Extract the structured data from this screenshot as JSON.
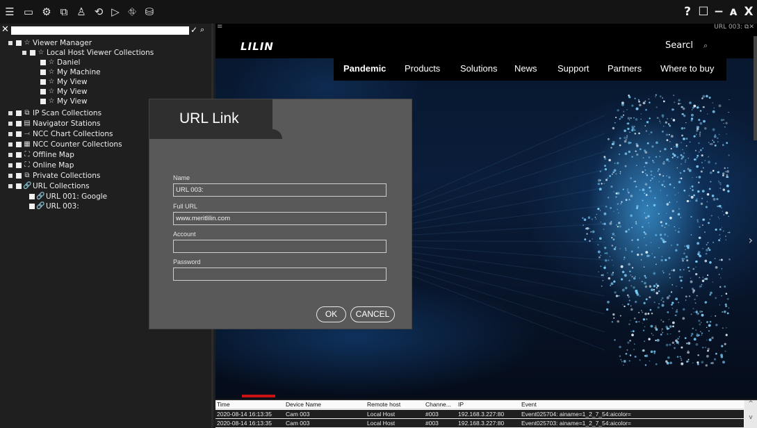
{
  "toolbar": {
    "icons": [
      "menu-icon",
      "monitor-icon",
      "settings-icon",
      "play-window-icon",
      "person-icon",
      "refresh-icon",
      "play-icon",
      "map-pin-icon",
      "database-icon"
    ],
    "glyphs": [
      "☰",
      "▭",
      "⚙",
      "⧉",
      "♙",
      "⟲",
      "▷",
      "⛗",
      "⛁"
    ],
    "window": {
      "help": "?",
      "maximize": "☐",
      "minimize": "−",
      "restore": "ᴀ",
      "close": "X"
    }
  },
  "filter": {
    "close": "✕",
    "confirm": "✓",
    "search": "⌕",
    "value": ""
  },
  "tree": [
    {
      "label": "Viewer Manager",
      "icon": "☆"
    },
    {
      "label": "Local Host Viewer Collections",
      "icon": "☆"
    },
    {
      "label": "Daniel",
      "icon": "☆"
    },
    {
      "label": "My Machine",
      "icon": "☆"
    },
    {
      "label": "My View",
      "icon": "☆"
    },
    {
      "label": "My View",
      "icon": "☆"
    },
    {
      "label": "My View",
      "icon": "☆"
    },
    {
      "label": "IP Scan Collections",
      "icon": "⧉"
    },
    {
      "label": "Navigator Stations",
      "icon": "▤"
    },
    {
      "label": "NCC Chart Collections",
      "icon": "⤙"
    },
    {
      "label": "NCC Counter Collections",
      "icon": "▦"
    },
    {
      "label": "Offline Map",
      "icon": "⛶"
    },
    {
      "label": "Online Map",
      "icon": "⛶"
    },
    {
      "label": "Private Collections",
      "icon": "⧉"
    },
    {
      "label": "URL Collections",
      "icon": "🔗"
    },
    {
      "label": "URL 001: Google",
      "icon": "🔗"
    },
    {
      "label": "URL 003:",
      "icon": "🔗"
    }
  ],
  "viewer": {
    "menu": "≡",
    "tab": "URL 003: ⧉✕",
    "site": {
      "logo": "LILIN",
      "search": "Searcl",
      "search_icon": "⌕",
      "nav": [
        "Pandemic",
        "Products",
        "Solutions",
        "News",
        "Support",
        "Partners",
        "Where to buy"
      ],
      "arrow": "›"
    }
  },
  "dialog": {
    "title": "URL Link",
    "fields": [
      {
        "label": "Name",
        "value": "URL 003:"
      },
      {
        "label": "Full URL",
        "value": "www.meritlilin.com"
      },
      {
        "label": "Account",
        "value": ""
      },
      {
        "label": "Password",
        "value": ""
      }
    ],
    "ok": "OK",
    "cancel": "CANCEL"
  },
  "eventlog": {
    "columns": [
      "Time",
      "Device Name",
      "Remote host",
      "Channe...",
      "IP",
      "Event"
    ],
    "rows": [
      [
        "2020-08-14 16:13:35",
        "Cam 003",
        "Local Host",
        "#003",
        "192.168.3.227:80",
        "Event025704: ainame=1_2_7_54:aicolor="
      ],
      [
        "2020-08-14 16:13:35",
        "Cam 003",
        "Local Host",
        "#003",
        "192.168.3.227:80",
        "Event025703: ainame=1_2_7_54:aicolor="
      ]
    ],
    "scroll_up": "^",
    "scroll_down": "v"
  }
}
